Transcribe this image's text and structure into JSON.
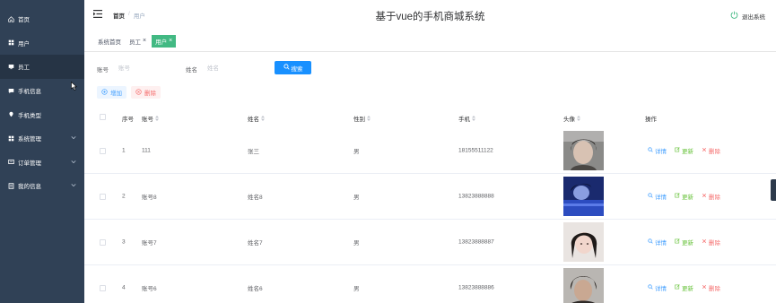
{
  "sidebar": {
    "items": [
      {
        "label": "首页",
        "icon": "home-icon"
      },
      {
        "label": "用户",
        "icon": "grid-icon"
      },
      {
        "label": "员工",
        "icon": "monitor-icon"
      },
      {
        "label": "手机信息",
        "icon": "message-icon"
      },
      {
        "label": "手机类型",
        "icon": "location-icon"
      },
      {
        "label": "系统管理",
        "icon": "grid-icon"
      },
      {
        "label": "订单管理",
        "icon": "cart-icon"
      },
      {
        "label": "我的信息",
        "icon": "document-icon"
      }
    ]
  },
  "header": {
    "breadcrumb_home": "首页",
    "breadcrumb_sep": "/",
    "breadcrumb_current": "用户",
    "title": "基于vue的手机商城系统",
    "logout": "退出系统"
  },
  "tags": {
    "items": [
      {
        "label": "系统首页"
      },
      {
        "label": "员工",
        "close": "×"
      },
      {
        "label": "用户",
        "close": "×"
      }
    ]
  },
  "search": {
    "account_label": "账号",
    "account_placeholder": "账号",
    "name_label": "姓名",
    "name_placeholder": "姓名",
    "button": "搜索"
  },
  "actions": {
    "add": "增加",
    "delete": "删除"
  },
  "table": {
    "columns": [
      "序号",
      "账号",
      "姓名",
      "性别",
      "手机",
      "头像",
      "操作"
    ],
    "rows": [
      {
        "index": "1",
        "account": "111",
        "name": "张三",
        "gender": "男",
        "phone": "18155511122"
      },
      {
        "index": "2",
        "account": "账号8",
        "name": "姓名8",
        "gender": "男",
        "phone": "13823888888"
      },
      {
        "index": "3",
        "account": "账号7",
        "name": "姓名7",
        "gender": "男",
        "phone": "13823888887"
      },
      {
        "index": "4",
        "account": "账号6",
        "name": "姓名6",
        "gender": "男",
        "phone": "13823888886"
      }
    ],
    "op_detail": "详情",
    "op_edit": "更新",
    "op_delete": "删除"
  },
  "colors": {
    "sidebar_bg": "#304156",
    "primary": "#1890ff",
    "tag_active": "#42b983",
    "success": "#67c23a",
    "danger": "#f56c6c"
  }
}
